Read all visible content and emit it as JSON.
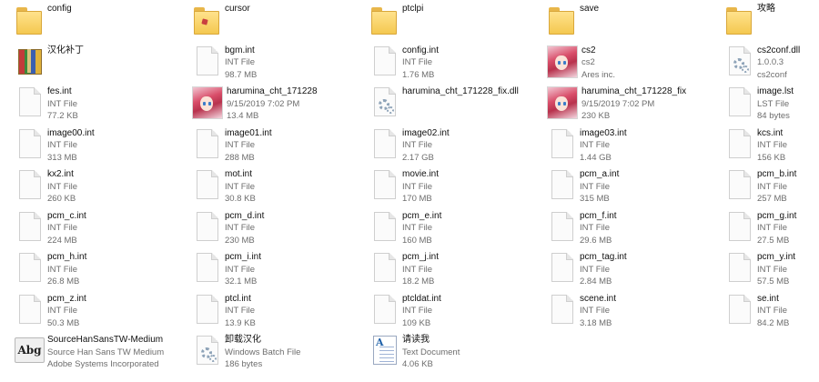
{
  "items": [
    {
      "name": "config",
      "line2": "",
      "line3": "",
      "icon": "folder-icon"
    },
    {
      "name": "cursor",
      "line2": "",
      "line3": "",
      "icon": "folder-icon"
    },
    {
      "name": "ptclpi",
      "line2": "",
      "line3": "",
      "icon": "folder-icon"
    },
    {
      "name": "save",
      "line2": "",
      "line3": "",
      "icon": "folder-icon"
    },
    {
      "name": "攻略",
      "line2": "",
      "line3": "",
      "icon": "folder-icon"
    },
    {
      "name": "汉化补丁",
      "line2": "",
      "line3": "",
      "icon": "archive-icon"
    },
    {
      "name": "bgm.int",
      "line2": "INT File",
      "line3": "98.7 MB",
      "icon": "file-icon"
    },
    {
      "name": "config.int",
      "line2": "INT File",
      "line3": "1.76 MB",
      "icon": "file-icon"
    },
    {
      "name": "cs2",
      "line2": "cs2",
      "line3": "Ares inc.",
      "icon": "anime-thumbnail-icon"
    },
    {
      "name": "cs2conf.dll",
      "line2": "1.0.0.3",
      "line3": "cs2conf",
      "icon": "gear-file-icon"
    },
    {
      "name": "fes.int",
      "line2": "INT File",
      "line3": "77.2 KB",
      "icon": "file-icon"
    },
    {
      "name": "harumina_cht_171228",
      "line2": "9/15/2019 7:02 PM",
      "line3": "13.4 MB",
      "icon": "anime-thumbnail-icon"
    },
    {
      "name": "harumina_cht_171228_fix.dll",
      "line2": "",
      "line3": "",
      "icon": "gear-file-icon"
    },
    {
      "name": "harumina_cht_171228_fix",
      "line2": "9/15/2019 7:02 PM",
      "line3": "230 KB",
      "icon": "anime-thumbnail-icon"
    },
    {
      "name": "image.lst",
      "line2": "LST File",
      "line3": "84 bytes",
      "icon": "file-icon"
    },
    {
      "name": "image00.int",
      "line2": "INT File",
      "line3": "313 MB",
      "icon": "file-icon"
    },
    {
      "name": "image01.int",
      "line2": "INT File",
      "line3": "288 MB",
      "icon": "file-icon"
    },
    {
      "name": "image02.int",
      "line2": "INT File",
      "line3": "2.17 GB",
      "icon": "file-icon"
    },
    {
      "name": "image03.int",
      "line2": "INT File",
      "line3": "1.44 GB",
      "icon": "file-icon"
    },
    {
      "name": "kcs.int",
      "line2": "INT File",
      "line3": "156 KB",
      "icon": "file-icon"
    },
    {
      "name": "kx2.int",
      "line2": "INT File",
      "line3": "260 KB",
      "icon": "file-icon"
    },
    {
      "name": "mot.int",
      "line2": "INT File",
      "line3": "30.8 KB",
      "icon": "file-icon"
    },
    {
      "name": "movie.int",
      "line2": "INT File",
      "line3": "170 MB",
      "icon": "file-icon"
    },
    {
      "name": "pcm_a.int",
      "line2": "INT File",
      "line3": "315 MB",
      "icon": "file-icon"
    },
    {
      "name": "pcm_b.int",
      "line2": "INT File",
      "line3": "257 MB",
      "icon": "file-icon"
    },
    {
      "name": "pcm_c.int",
      "line2": "INT File",
      "line3": "224 MB",
      "icon": "file-icon"
    },
    {
      "name": "pcm_d.int",
      "line2": "INT File",
      "line3": "230 MB",
      "icon": "file-icon"
    },
    {
      "name": "pcm_e.int",
      "line2": "INT File",
      "line3": "160 MB",
      "icon": "file-icon"
    },
    {
      "name": "pcm_f.int",
      "line2": "INT File",
      "line3": "29.6 MB",
      "icon": "file-icon"
    },
    {
      "name": "pcm_g.int",
      "line2": "INT File",
      "line3": "27.5 MB",
      "icon": "file-icon"
    },
    {
      "name": "pcm_h.int",
      "line2": "INT File",
      "line3": "26.8 MB",
      "icon": "file-icon"
    },
    {
      "name": "pcm_i.int",
      "line2": "INT File",
      "line3": "32.1 MB",
      "icon": "file-icon"
    },
    {
      "name": "pcm_j.int",
      "line2": "INT File",
      "line3": "18.2 MB",
      "icon": "file-icon"
    },
    {
      "name": "pcm_tag.int",
      "line2": "INT File",
      "line3": "2.84 MB",
      "icon": "file-icon"
    },
    {
      "name": "pcm_y.int",
      "line2": "INT File",
      "line3": "57.5 MB",
      "icon": "file-icon"
    },
    {
      "name": "pcm_z.int",
      "line2": "INT File",
      "line3": "50.3 MB",
      "icon": "file-icon"
    },
    {
      "name": "ptcl.int",
      "line2": "INT File",
      "line3": "13.9 KB",
      "icon": "file-icon"
    },
    {
      "name": "ptcldat.int",
      "line2": "INT File",
      "line3": "109 KB",
      "icon": "file-icon"
    },
    {
      "name": "scene.int",
      "line2": "INT File",
      "line3": "3.18 MB",
      "icon": "file-icon"
    },
    {
      "name": "se.int",
      "line2": "INT File",
      "line3": "84.2 MB",
      "icon": "file-icon"
    },
    {
      "name": "SourceHanSansTW-Medium",
      "line2": "Source Han Sans TW Medium",
      "line3": "Adobe Systems Incorporated",
      "icon": "font-file-icon",
      "glyph": "Abg"
    },
    {
      "name": "卸载汉化",
      "line2": "Windows Batch File",
      "line3": "186 bytes",
      "icon": "gear-file-icon"
    },
    {
      "name": "请读我",
      "line2": "Text Document",
      "line3": "4.06 KB",
      "icon": "text-document-icon"
    }
  ]
}
